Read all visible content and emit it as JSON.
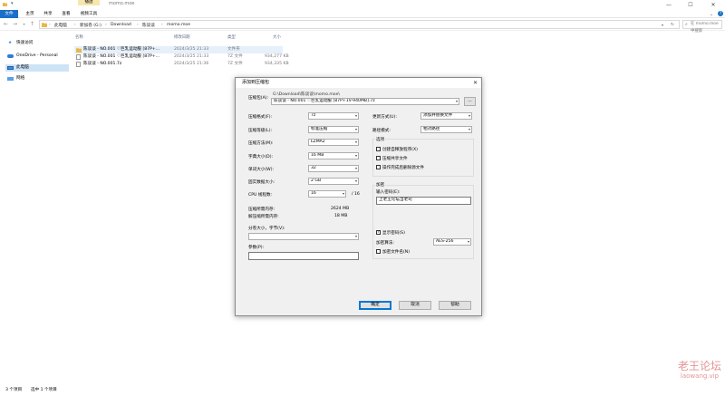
{
  "window": {
    "title": "momo.moe",
    "context_tab": "播放",
    "min": "—",
    "max": "☐",
    "close": "✕"
  },
  "ribbon": {
    "tabs": [
      "文件",
      "主页",
      "共享",
      "查看",
      "视频工具"
    ]
  },
  "address": {
    "crumbs": [
      "此电脑",
      "新加卷 (G:)",
      "Download",
      "陈谈谈",
      "momo.moe"
    ],
    "search_placeholder": "在 momo.moe 中搜索"
  },
  "sidebar": {
    "items": [
      {
        "label": "快速访问",
        "icon": "star-icon"
      },
      {
        "label": "OneDrive - Personal",
        "icon": "cloud-icon"
      },
      {
        "label": "此电脑",
        "icon": "computer-icon"
      },
      {
        "label": "网络",
        "icon": "network-icon"
      }
    ]
  },
  "files": {
    "columns": [
      "名称",
      "修改日期",
      "类型",
      "大小"
    ],
    "rows": [
      {
        "name": "陈谈谈 - NO.001 ♡巨乳运动服 [87P+...",
        "date": "2024/3/25 21:33",
        "type": "文件夹",
        "size": ""
      },
      {
        "name": "陈谈谈 - NO.001 ♡巨乳运动服 [87P+...",
        "date": "2024/3/25 21:33",
        "type": "7Z 文件",
        "size": "934,277 KB"
      },
      {
        "name": "陈谈谈 - NO.001.7z",
        "date": "2024/3/25 21:36",
        "type": "7Z 文件",
        "size": "934,335 KB"
      }
    ]
  },
  "status": {
    "count": "3 个项目",
    "selected": "选中 1 个项目"
  },
  "watermark": {
    "line1": "老王论坛",
    "line2": "laowang.vip"
  },
  "dialog": {
    "title": "添加到压缩包",
    "archive_label": "压缩包(A):",
    "archive_path": "G:\\Download\\陈谈谈\\momo.moe\\",
    "archive_name": "陈谈谈 - NO.001 ♡巨乳运动服 [87P+1V-940MB].7z",
    "browse": "...",
    "left": [
      {
        "label": "压缩格式(F):",
        "value": "7z"
      },
      {
        "label": "压缩等级(L):",
        "value": "标准压缩"
      },
      {
        "label": "压缩方法(M):",
        "value": "LZMA2"
      },
      {
        "label": "字典大小(D):",
        "value": "16 MB"
      },
      {
        "label": "单词大小(W):",
        "value": "32"
      },
      {
        "label": "固实数据大小:",
        "value": "2 GB"
      }
    ],
    "cpu_label": "CPU 线程数:",
    "cpu_value": "16",
    "cpu_total": "/ 16",
    "mem_compress_label": "压缩所需内存:",
    "mem_compress_value": "2624 MB",
    "mem_decompress_label": "解压缩所需内存:",
    "mem_decompress_value": "18 MB",
    "split_label": "分卷大小，字节(V):",
    "params_label": "参数(P):",
    "update_label": "更新方式(U):",
    "update_value": "添加并替换文件",
    "path_label": "路径模式:",
    "path_value": "相对路径",
    "options_title": "选项",
    "options": [
      {
        "label": "创建自释放程序(X)",
        "checked": false
      },
      {
        "label": "压缩共享文件",
        "checked": false
      },
      {
        "label": "操作完成后删除源文件",
        "checked": false
      }
    ],
    "enc_title": "加密",
    "password_label": "输入密码(E):",
    "password_value": "上老王论坛当老司",
    "show_password": "显示密码(S)",
    "method_label": "加密算法:",
    "method_value": "AES-256",
    "encrypt_names": "加密文件名(N)",
    "ok": "确定",
    "cancel": "取消",
    "help": "帮助"
  }
}
